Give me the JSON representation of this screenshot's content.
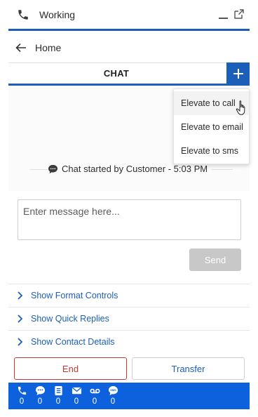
{
  "header": {
    "status": "Working"
  },
  "nav": {
    "back_label": "Home"
  },
  "tabs": {
    "active": "CHAT"
  },
  "elevate_menu": {
    "items": [
      {
        "label": "Elevate to call"
      },
      {
        "label": "Elevate to email"
      },
      {
        "label": "Elevate to sms"
      }
    ]
  },
  "transcript": {
    "event": "Chat started by Customer - 5:03 PM"
  },
  "composer": {
    "placeholder": "Enter message here...",
    "value": "",
    "send_label": "Send"
  },
  "sections": {
    "items": [
      {
        "label": "Show Format Controls"
      },
      {
        "label": "Show Quick Replies"
      },
      {
        "label": "Show Contact Details"
      }
    ]
  },
  "actions": {
    "end_label": "End",
    "transfer_label": "Transfer"
  },
  "status_counts": [
    {
      "icon": "phone-icon",
      "count": "0"
    },
    {
      "icon": "chat-icon",
      "count": "0"
    },
    {
      "icon": "document-icon",
      "count": "0"
    },
    {
      "icon": "email-icon",
      "count": "0"
    },
    {
      "icon": "voicemail-icon",
      "count": "0"
    },
    {
      "icon": "sms-icon",
      "count": "0"
    }
  ],
  "colors": {
    "brand_blue": "#1b5fb8",
    "status_bar": "#0e61dc",
    "end_red": "#c23934",
    "disabled_gray": "#c8c8c8"
  }
}
